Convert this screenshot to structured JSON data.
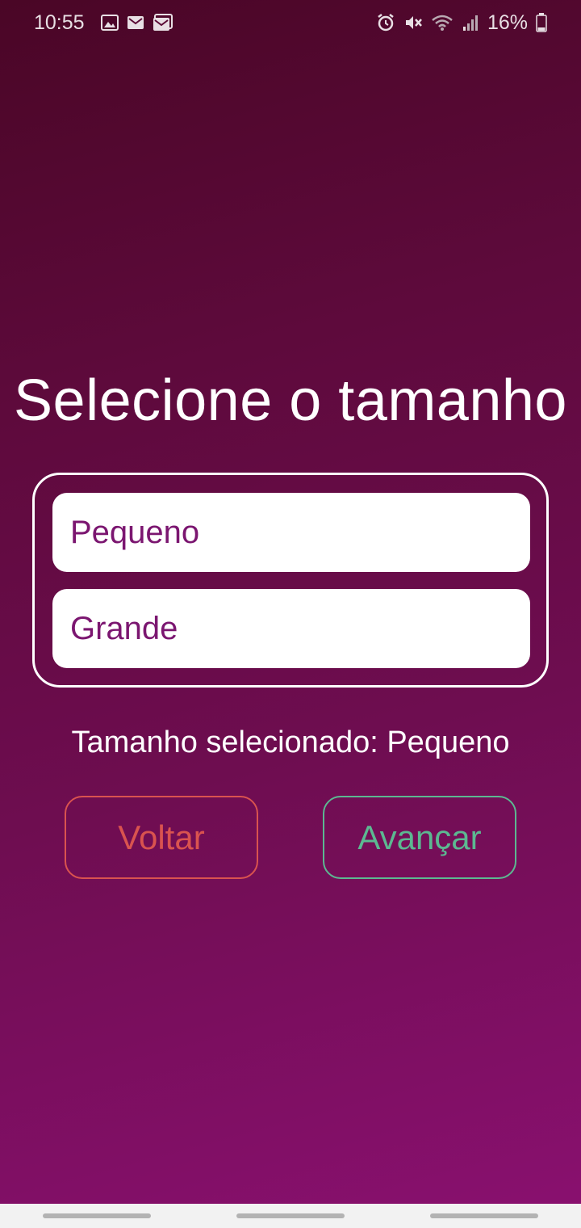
{
  "status_bar": {
    "time": "10:55",
    "left_icons": [
      "image-icon",
      "gmail-icon",
      "gmail-icon"
    ],
    "right_icons": [
      "alarm-icon",
      "mute-icon",
      "wifi-icon",
      "signal-icon"
    ],
    "battery": "16%"
  },
  "screen": {
    "title": "Selecione o tamanho",
    "options": [
      {
        "label": "Pequeno"
      },
      {
        "label": "Grande"
      }
    ],
    "selected_text": "Tamanho selecionado: Pequeno",
    "back_label": "Voltar",
    "next_label": "Avançar"
  },
  "colors": {
    "background_top": "#4a0626",
    "background_bottom": "#8a1070",
    "option_text": "#7b1670",
    "back_button": "#d9534f",
    "next_button": "#5cb891"
  }
}
